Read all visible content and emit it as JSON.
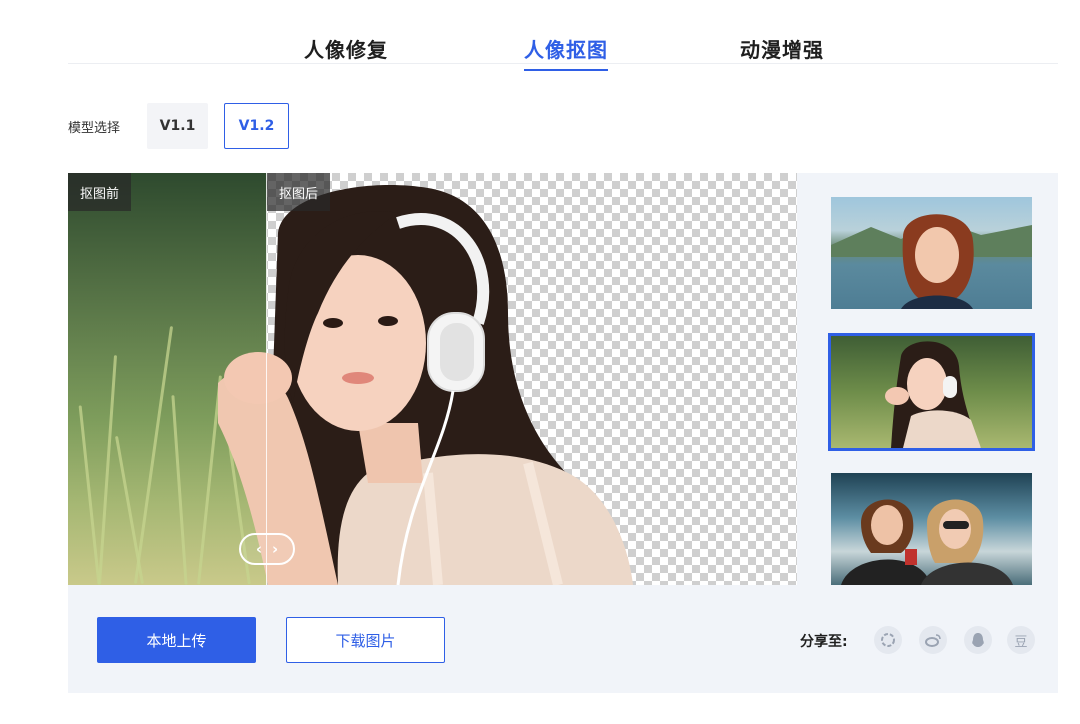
{
  "tabs": [
    {
      "label": "人像修复",
      "active": false
    },
    {
      "label": "人像抠图",
      "active": true
    },
    {
      "label": "动漫增强",
      "active": false
    }
  ],
  "model_select": {
    "label": "模型选择",
    "options": [
      "V1.1",
      "V1.2"
    ],
    "selected": "V1.2"
  },
  "stage": {
    "before_tag": "抠图前",
    "after_tag": "抠图后",
    "handle_left": "‹",
    "handle_right": "›"
  },
  "thumbnails": [
    {
      "name": "red-hair-woman-lake",
      "selected": false
    },
    {
      "name": "girl-headphones-grass",
      "selected": true
    },
    {
      "name": "couple-rocks",
      "selected": false
    }
  ],
  "actions": {
    "upload_label": "本地上传",
    "download_label": "下载图片"
  },
  "share": {
    "label": "分享至:",
    "icons": [
      "circle-share-icon",
      "weibo-icon",
      "qq-icon",
      "douban-icon"
    ],
    "douban_char": "豆"
  },
  "colors": {
    "accent": "#2f5fe6",
    "panel": "#f1f4f9"
  }
}
